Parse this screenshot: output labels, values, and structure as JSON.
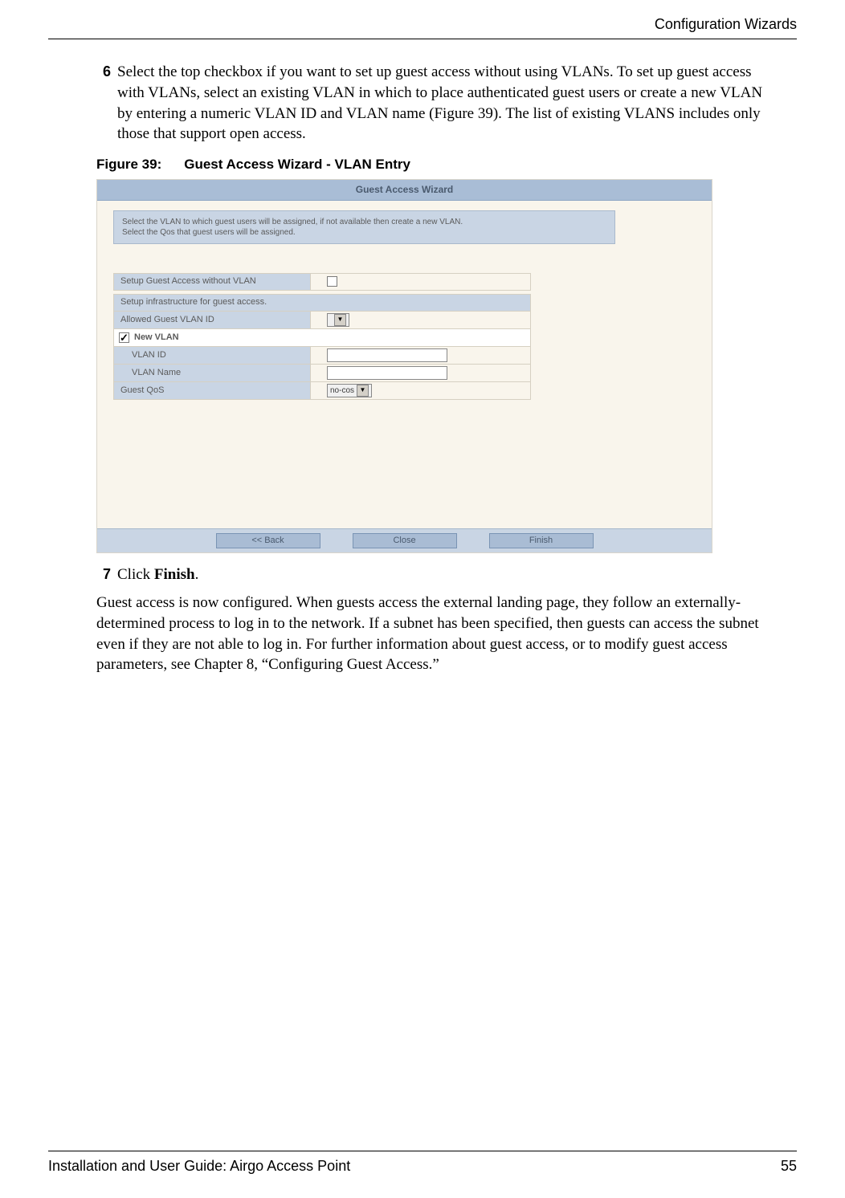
{
  "header": {
    "section": "Configuration Wizards"
  },
  "steps": {
    "step6": {
      "num": "6",
      "text": "Select the top checkbox if you want to set up guest access without using VLANs. To set up guest access with VLANs, select an existing VLAN in which to place authenticated guest users or create a new VLAN by entering a numeric VLAN ID and VLAN name (Figure 39). The list of existing VLANS includes only those that support open access."
    },
    "step7": {
      "num": "7",
      "prefix": "Click ",
      "bold": "Finish",
      "suffix": "."
    }
  },
  "figure": {
    "label": "Figure 39:",
    "title": "Guest Access Wizard - VLAN Entry"
  },
  "wizard": {
    "title": "Guest Access Wizard",
    "instruction_line1": "Select the VLAN to which guest users will be assigned, if not available then create a new VLAN.",
    "instruction_line2": "Select the Qos that guest users will be assigned.",
    "setup_without_vlan": "Setup Guest Access without VLAN",
    "infrastructure_header": "Setup infrastructure for guest access.",
    "allowed_guest_vlan_id": "Allowed Guest VLAN ID",
    "new_vlan": "New VLAN",
    "vlan_id": "VLAN ID",
    "vlan_name": "VLAN Name",
    "guest_qos": "Guest QoS",
    "qos_value": "no-cos",
    "buttons": {
      "back": "<< Back",
      "close": "Close",
      "finish": "Finish"
    }
  },
  "paragraph": "Guest access is now configured. When guests access the external landing page, they follow an externally-determined process to log in to the network. If a subnet has been specified, then guests can access the subnet even if they are not able to log in. For further information about guest access, or to modify guest access parameters, see Chapter 8,  “Configuring Guest Access.”",
  "footer": {
    "left": "Installation and User Guide: Airgo Access Point",
    "right": "55"
  }
}
